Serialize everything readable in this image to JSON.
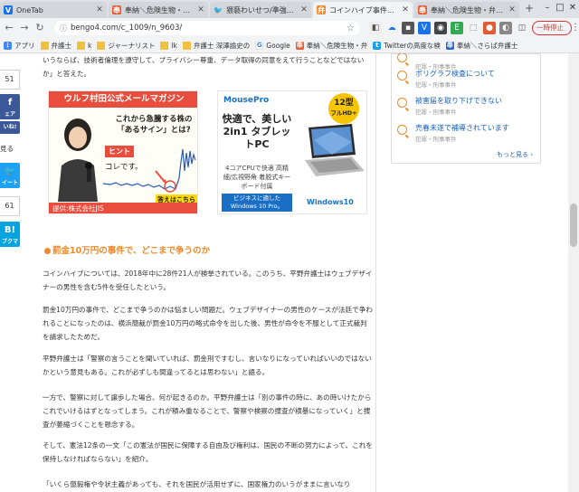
{
  "browser": {
    "tabs": [
      {
        "title": "OneTab",
        "favicon": "onetab-icon",
        "active": false
      },
      {
        "title": "奉納＼危険生物・弁護士",
        "favicon": "page-icon",
        "active": false
      },
      {
        "title": "猥褻わいせつ/準強姦/資…",
        "favicon": "twitter-icon",
        "active": false
      },
      {
        "title": "コインハイブ事件、無罪判…",
        "favicon": "page-icon",
        "active": true
      },
      {
        "title": "奉納＼危険生物・弁護士・",
        "favicon": "page-icon",
        "active": false
      }
    ],
    "new_tab_symbol": "+",
    "minimize": "–",
    "maximize": "□",
    "close": "✕",
    "url": "bengo4.com/c_1009/n_9603/",
    "pause_label": "一時停止",
    "bookmarks": [
      {
        "label": "アプリ",
        "icon": "apps-grid-icon"
      },
      {
        "label": "弁護士",
        "icon": "folder-icon"
      },
      {
        "label": "k",
        "icon": "folder-icon"
      },
      {
        "label": "ジャーナリスト",
        "icon": "folder-icon"
      },
      {
        "label": "lk",
        "icon": "folder-icon"
      },
      {
        "label": "弁護士 深澤諭史の",
        "icon": "folder-icon"
      },
      {
        "label": "Google",
        "icon": "google-icon"
      },
      {
        "label": "奉納＼危険生物・弁",
        "icon": "page-icon"
      },
      {
        "label": "Twitterの高度な検",
        "icon": "twitter-icon"
      },
      {
        "label": "奉納＼さらば弁護士",
        "icon": "page-icon"
      }
    ]
  },
  "share": {
    "count_top": "51",
    "share_label": "ェア",
    "like_label": "いね!",
    "view_label": "見る",
    "tweet_label": "イート",
    "count_mid": "61",
    "hatena_label": "B!",
    "hatena_sub": "ブクマ"
  },
  "article": {
    "intro": "いうならば、技術者倫理を遵守して、プライバシー尊重、データ取得の同意をえて行うことなどではないか」と答えた。",
    "heading": "罰金10万円の事件で、どこまで争うのか",
    "paragraphs": [
      "コインハイブについては、2018年中に28件21人が検挙されている。このうち、平野弁護士はウェブデザイナーの男性を含む5件を受任したという。",
      "罰金10万円の事件で、どこまで争うのかは悩ましい問題だ。ウェブデザイナーの男性のケースが法廷で争われることになったのは、横浜簡裁が罰金10万円の略式命令を出した後、男性が命令を不服として正式裁判を請求したためだ。",
      "平野弁護士は「警察の言うことを聞いていれば、罰金刑ですむし、言いなりになっていればいいのではないかという意見もある。これが必ずしも間違ってるとは思わない」と語る。",
      "一方で、警察に対して譲歩した場合、何が起きるのか。平野弁護士は「別の事件の時に、あの時いけたからこれでいけるはずとなってしまう。これが積み重なることで、警察や検察の捜査が横暴になっていく」と捜査が萎縮づくことを懸念する。",
      "そして、憲法12条の一文「この憲法が国民に保障する自由及び権利は、国民の不断の努力によって、これを保持しなければならない」を紹介。",
      "「いくら懲毅権や令状主義があっても、それを国民が活用せずに、国家権力のいうがままに言いなり"
    ]
  },
  "ad1": {
    "title": "ウルフ村田公式メールマガジン",
    "line1": "これから急騰する株の",
    "line2": "「あるサイン」とは?",
    "hint": "ヒント",
    "hint2": "コレです。",
    "answer": "答えはこちら",
    "footer": "提供:株式会社JIS"
  },
  "ad2": {
    "brand": "MousePro",
    "badge_line1": "12型",
    "badge_line2": "フルHD+",
    "headline": "快適で、美しい 2in1 タブレットPC",
    "spec": "4コアCPUで快適 高精細/広視野角 着脱式キーボード付属",
    "bottom": "ビジネスに適した Windows 10 Pro。",
    "os": "Windows10"
  },
  "sidebar": {
    "items": [
      {
        "title": "",
        "category": "犯罪・刑事事件"
      },
      {
        "title": "ポリグラフ検査について",
        "category": "犯罪・刑事事件"
      },
      {
        "title": "被害届を取り下げできない",
        "category": "犯罪・刑事事件"
      },
      {
        "title": "売春未遂で補導されています",
        "category": "犯罪・刑事事件"
      }
    ],
    "more": "もっと見る"
  }
}
